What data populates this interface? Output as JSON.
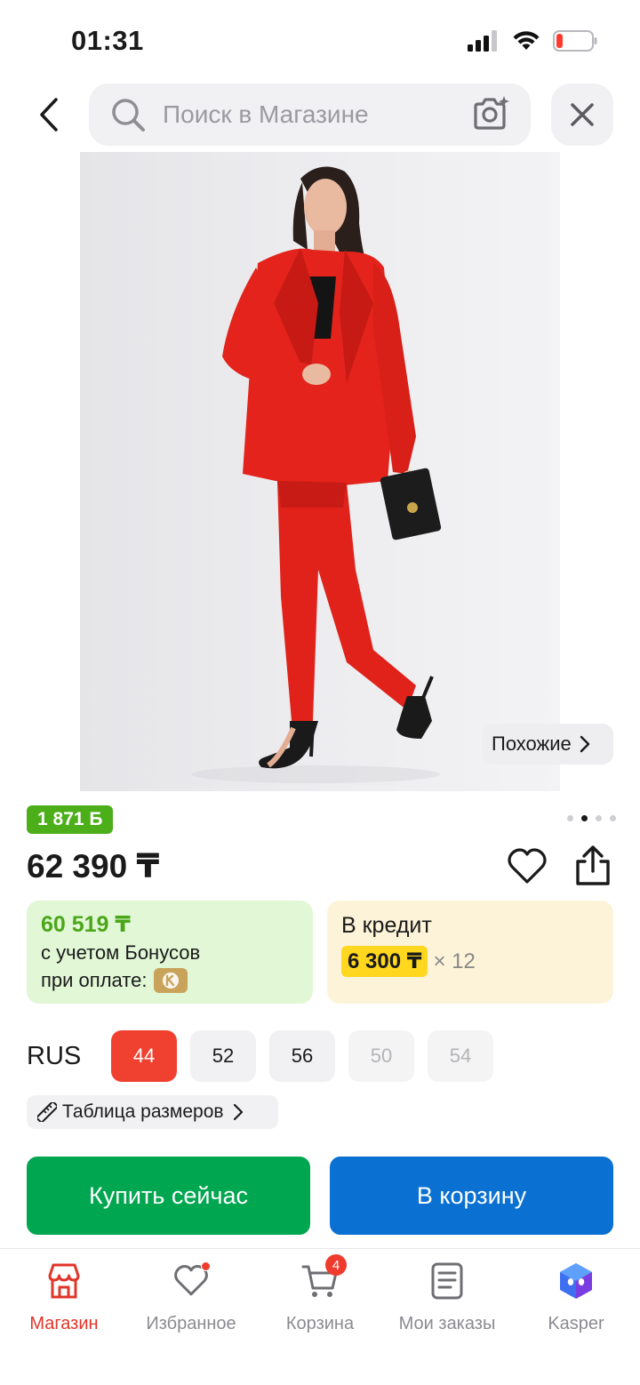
{
  "status_bar": {
    "time": "01:31",
    "battery_level": 0.15
  },
  "search": {
    "placeholder": "Поиск в Магазине"
  },
  "product": {
    "image_dots": {
      "count": 4,
      "active_index": 1
    },
    "similar_label": "Похожие",
    "bonus_badge": "1 871 Б",
    "price": "62 390 ₸",
    "bonus_price": {
      "amount": "60 519 ₸",
      "line1": "с учетом Бонусов",
      "line2": "при оплате:"
    },
    "credit": {
      "title": "В кредит",
      "monthly": "6 300 ₸",
      "months": "× 12"
    },
    "sizes": {
      "system": "RUS",
      "options": [
        {
          "label": "44",
          "state": "selected"
        },
        {
          "label": "52",
          "state": "available"
        },
        {
          "label": "56",
          "state": "available"
        },
        {
          "label": "50",
          "state": "unavailable"
        },
        {
          "label": "54",
          "state": "unavailable"
        }
      ],
      "table_label": "Таблица размеров"
    }
  },
  "actions": {
    "buy_now": "Купить сейчас",
    "add_to_cart": "В корзину"
  },
  "bottom_nav": {
    "items": [
      {
        "label": "Магазин",
        "icon": "store-icon",
        "active": true
      },
      {
        "label": "Избранное",
        "icon": "heart-icon",
        "dot": true
      },
      {
        "label": "Корзина",
        "icon": "cart-icon",
        "badge": "4"
      },
      {
        "label": "Мои заказы",
        "icon": "orders-icon"
      },
      {
        "label": "Kasper",
        "icon": "kasper-icon"
      }
    ]
  },
  "colors": {
    "accent_red": "#f04130",
    "buy_green": "#00a650",
    "cart_blue": "#0a70d2",
    "bonus_green": "#4caf1a",
    "credit_yellow": "#ffd71e"
  }
}
